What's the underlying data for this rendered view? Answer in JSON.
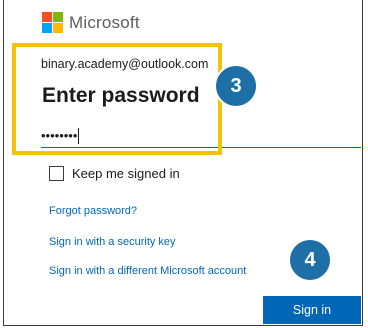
{
  "brand": {
    "name": "Microsoft",
    "logo_colors": [
      "#f25022",
      "#7fba00",
      "#00a4ef",
      "#ffb900"
    ]
  },
  "account": {
    "email": "binary.academy@outlook.com"
  },
  "form": {
    "heading": "Enter password",
    "password_masked": "••••••••"
  },
  "options": {
    "keep_signed_in_label": "Keep me signed in",
    "keep_signed_in_checked": false
  },
  "links": {
    "forgot_password": "Forgot password?",
    "security_key": "Sign in with a security key",
    "different_account": "Sign in with a different Microsoft account"
  },
  "actions": {
    "sign_in_label": "Sign in"
  },
  "annotations": {
    "step_3": "3",
    "step_4": "4",
    "highlight_color": "#f4c20d",
    "badge_color": "#1e6fa6"
  }
}
